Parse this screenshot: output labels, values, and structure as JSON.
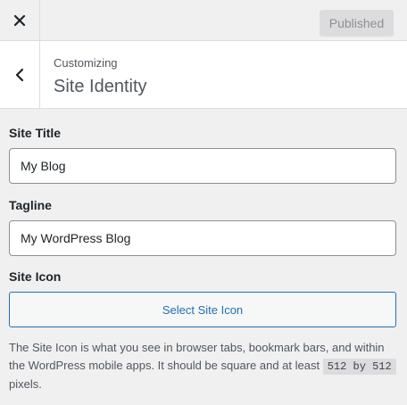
{
  "topbar": {
    "close_icon": "close-icon",
    "publish_label": "Published"
  },
  "header": {
    "back_icon": "chevron-left-icon",
    "subtitle": "Customizing",
    "title": "Site Identity"
  },
  "site_title": {
    "label": "Site Title",
    "value": "My Blog"
  },
  "tagline": {
    "label": "Tagline",
    "value": "My WordPress Blog"
  },
  "site_icon": {
    "label": "Site Icon",
    "button_label": "Select Site Icon",
    "description_before": "The Site Icon is what you see in browser tabs, bookmark bars, and within the WordPress mobile apps. It should be square and at least ",
    "description_code": "512 by 512",
    "description_after": " pixels."
  },
  "colors": {
    "accent": "#2271b1",
    "background": "#f0f0f1",
    "border": "#dcdcde"
  }
}
